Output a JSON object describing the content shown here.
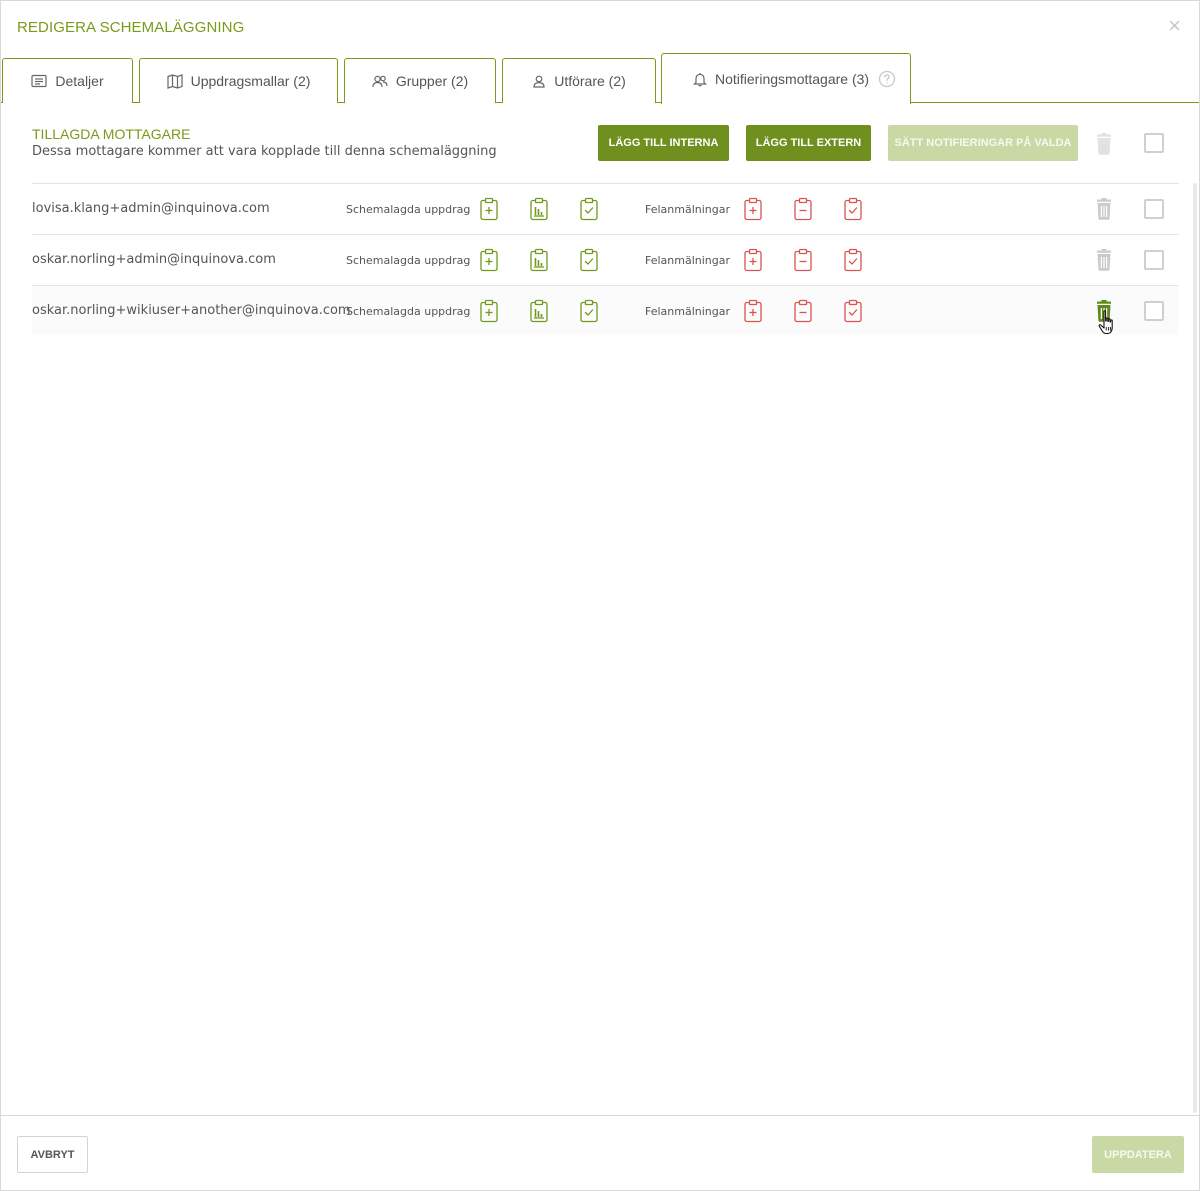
{
  "dialog": {
    "title": "REDIGERA SCHEMALÄGGNING",
    "close_glyph": "×"
  },
  "tabs": [
    {
      "label": "Detaljer",
      "icon": "list-icon",
      "active": false
    },
    {
      "label": "Uppdragsmallar (2)",
      "icon": "map-icon",
      "active": false
    },
    {
      "label": "Grupper (2)",
      "icon": "users-icon",
      "active": false
    },
    {
      "label": "Utförare (2)",
      "icon": "user-icon",
      "active": false
    },
    {
      "label": "Notifieringsmottagare (3)",
      "icon": "bell-icon",
      "active": true,
      "help_icon": "question-circle-icon"
    }
  ],
  "recipients_section": {
    "title": "TILLAGDA MOTTAGARE",
    "subtitle": "Dessa mottagare kommer att vara kopplade till denna schemaläggning",
    "add_internal_label": "LÄGG TILL INTERNA",
    "add_external_label": "LÄGG TILL EXTERN",
    "set_notifications_label": "SÄTT NOTIFIERINGAR PÅ VALDA",
    "set_notifications_disabled": true
  },
  "recipients": [
    {
      "email": "lovisa.klang+admin@inquinova.com",
      "scheduled_label": "Schemalagda uppdrag",
      "fault_label": "Felanmälningar",
      "checked": false
    },
    {
      "email": "oskar.norling+admin@inquinova.com",
      "scheduled_label": "Schemalagda uppdrag",
      "fault_label": "Felanmälningar",
      "checked": false
    },
    {
      "email": "oskar.norling+wikiuser+another@inquinova.com",
      "scheduled_label": "Schemalagda uppdrag",
      "fault_label": "Felanmälningar",
      "checked": false,
      "hovered": true
    }
  ],
  "colors": {
    "accent": "#7a9a1a",
    "button": "#6f8f1e",
    "button_disabled": "#c9d8a4",
    "scheduled_icon": "#6f9a1e",
    "fault_icon": "#d9534f",
    "trash_inactive": "#cccccc",
    "trash_active": "#5f8a1a"
  },
  "footer": {
    "cancel_label": "AVBRYT",
    "update_label": "UPPDATERA",
    "update_disabled": true
  }
}
